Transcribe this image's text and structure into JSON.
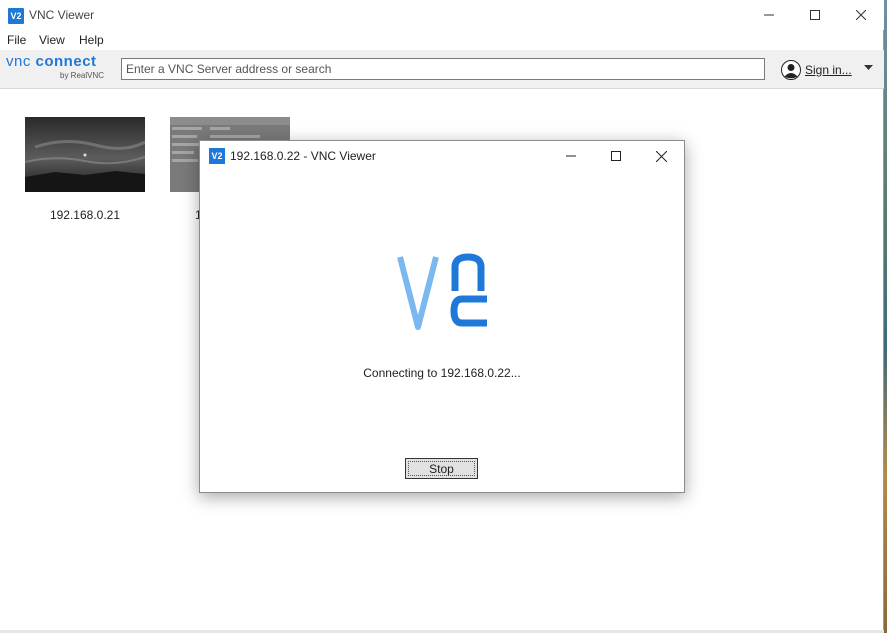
{
  "window": {
    "title": "VNC Viewer",
    "icon_text": "V2"
  },
  "menu": [
    "File",
    "View",
    "Help"
  ],
  "toolbar": {
    "logo_text_left": "vnc",
    "logo_text_right": "connect",
    "logo_sub": "by RealVNC",
    "search_placeholder": "Enter a VNC Server address or search",
    "sign_in_label": "Sign in..."
  },
  "address_book": [
    {
      "label": "192.168.0.21"
    },
    {
      "label": "1"
    }
  ],
  "dialog": {
    "title": "192.168.0.22 - VNC Viewer",
    "icon_text": "V2",
    "message": "Connecting to 192.168.0.22...",
    "stop_label": "Stop"
  },
  "colors": {
    "brand_blue": "#1e78d8",
    "logo_light_blue": "#7ab8f0"
  }
}
